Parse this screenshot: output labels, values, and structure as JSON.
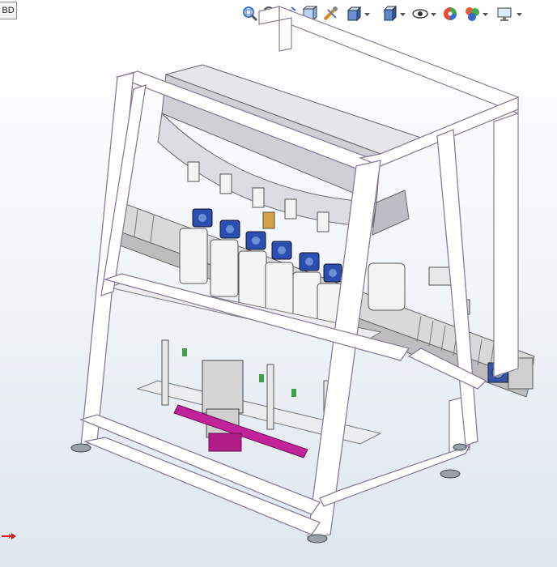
{
  "window": {
    "tab_label": "BD"
  },
  "heads_up_toolbar": {
    "buttons": [
      {
        "icon": "zoom-to-fit-icon",
        "has_dropdown": false
      },
      {
        "icon": "zoom-to-area-icon",
        "has_dropdown": false
      },
      {
        "icon": "previous-view-icon",
        "has_dropdown": false
      },
      {
        "icon": "section-view-icon",
        "has_dropdown": false
      },
      {
        "icon": "dynamic-annotation-icon",
        "has_dropdown": false
      },
      {
        "icon": "view-orientation-icon",
        "has_dropdown": true
      },
      {
        "icon": "display-style-icon",
        "has_dropdown": true
      },
      {
        "icon": "hide-show-items-icon",
        "has_dropdown": true
      },
      {
        "icon": "edit-appearance-icon",
        "has_dropdown": false
      },
      {
        "icon": "apply-scene-icon",
        "has_dropdown": true
      },
      {
        "icon": "view-settings-icon",
        "has_dropdown": true
      }
    ]
  },
  "model": {
    "description_icon": "filling-machine-assembly-icon",
    "colors": {
      "frame_fill": "#ffffff",
      "frame_edge": "#8a7c95",
      "frame_shade": "#c9c2d0",
      "tank": "#e4e4e8",
      "cylinder": "#f2f2f2",
      "valve_blue": "#2a4fb0",
      "accent_magenta": "#c1239a",
      "conveyor": "#d8d8d8",
      "feet": "#9aa0a8"
    }
  },
  "triad": {
    "axis_label": "X"
  }
}
